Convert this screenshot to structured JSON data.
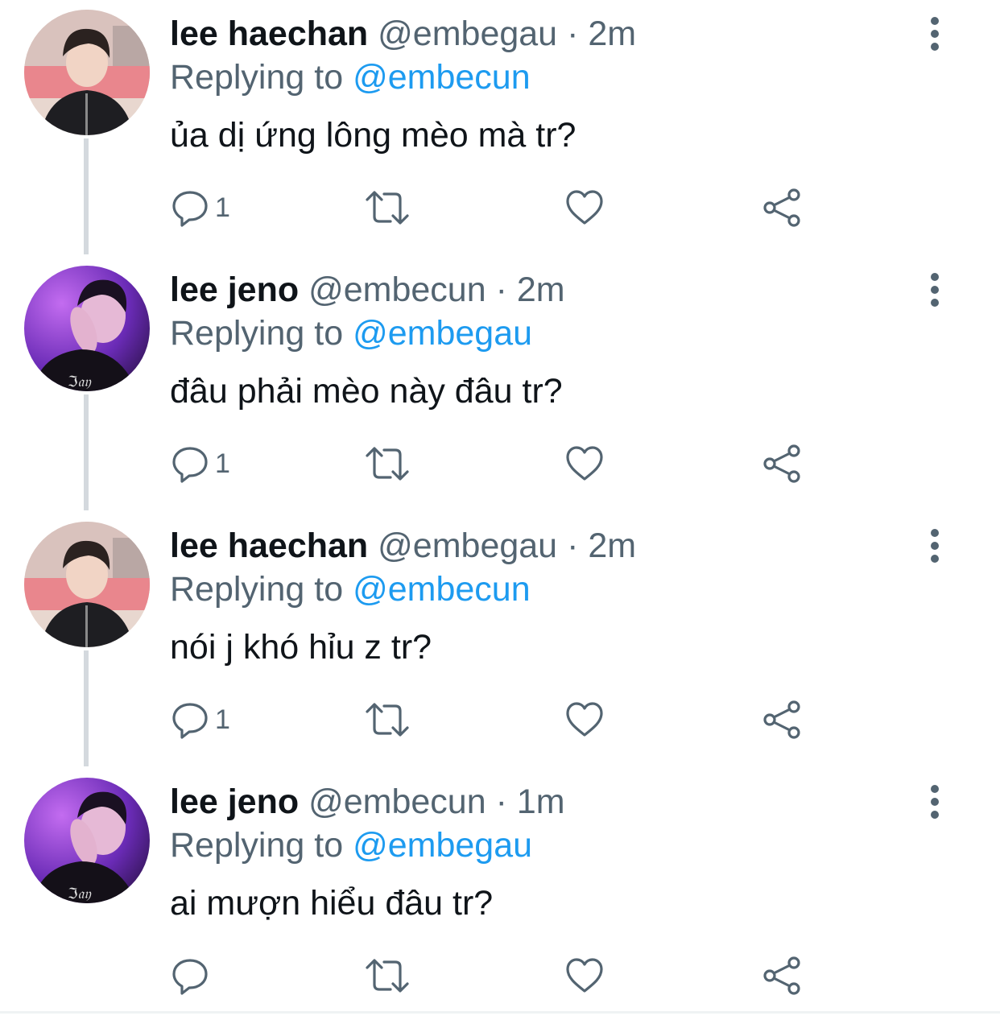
{
  "tweets": [
    {
      "name": "lee haechan",
      "handle": "@embegau",
      "separator": "·",
      "time": "2m",
      "replying_prefix": "Replying to",
      "replying_to": "@embecun",
      "text": "ủa dị ứng lông mèo mà tr?",
      "reply_count": "1",
      "avatar": "haechan-avatar"
    },
    {
      "name": "lee jeno",
      "handle": "@embecun",
      "separator": "·",
      "time": "2m",
      "replying_prefix": "Replying to",
      "replying_to": "@embegau",
      "text": "đâu phải mèo này đâu tr?",
      "reply_count": "1",
      "avatar": "jeno-avatar"
    },
    {
      "name": "lee haechan",
      "handle": "@embegau",
      "separator": "·",
      "time": "2m",
      "replying_prefix": "Replying to",
      "replying_to": "@embecun",
      "text": "nói j khó hỉu z tr?",
      "reply_count": "1",
      "avatar": "haechan-avatar"
    },
    {
      "name": "lee jeno",
      "handle": "@embecun",
      "separator": "·",
      "time": "1m",
      "replying_prefix": "Replying to",
      "replying_to": "@embegau",
      "text": "ai mượn hiểu đâu tr?",
      "reply_count": "",
      "avatar": "jeno-avatar"
    }
  ],
  "icons": {
    "reply": "reply-icon",
    "retweet": "retweet-icon",
    "like": "heart-icon",
    "share": "share-icon",
    "more": "more-vertical-icon"
  },
  "colors": {
    "name": "#0f1419",
    "secondary": "#536471",
    "mention": "#1d9bf0",
    "thread_line": "#d4d9de"
  }
}
